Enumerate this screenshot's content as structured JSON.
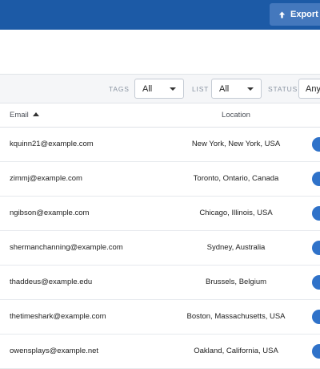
{
  "header": {
    "export_label": "Export",
    "export_icon": "export-upload-icon",
    "bar_color": "#1c5aa6"
  },
  "filters": {
    "tags": {
      "label": "TAGS",
      "value": "All"
    },
    "list": {
      "label": "LIST",
      "value": "All"
    },
    "status": {
      "label": "STATUS",
      "value": "Any"
    }
  },
  "table": {
    "columns": {
      "email": "Email",
      "location": "Location"
    },
    "sort": "email-ascending",
    "rows": [
      {
        "email": "kquinn21@example.com",
        "location": "New York, New York, USA"
      },
      {
        "email": "zimmj@example.com",
        "location": "Toronto, Ontario, Canada"
      },
      {
        "email": "ngibson@example.com",
        "location": "Chicago, Illinois, USA"
      },
      {
        "email": "shermanchanning@example.com",
        "location": "Sydney, Australia"
      },
      {
        "email": "thaddeus@example.edu",
        "location": "Brussels, Belgium"
      },
      {
        "email": "thetimeshark@example.com",
        "location": "Boston, Massachusetts, USA"
      },
      {
        "email": "owensplays@example.net",
        "location": "Oakland, California, USA"
      }
    ]
  }
}
